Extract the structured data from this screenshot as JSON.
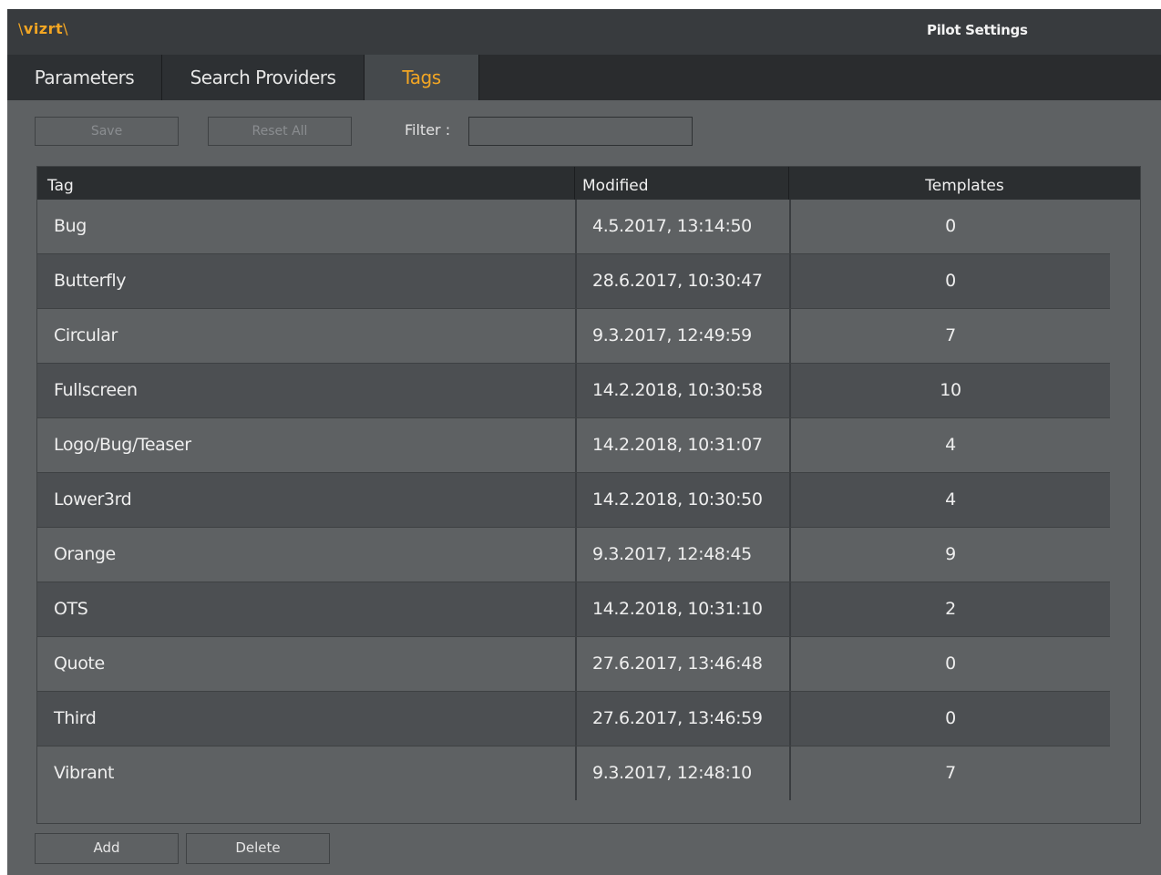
{
  "window": {
    "logo": "vizrt",
    "title": "Pilot Settings"
  },
  "tabs": [
    {
      "label": "Parameters",
      "active": false
    },
    {
      "label": "Search Providers",
      "active": false
    },
    {
      "label": "Tags",
      "active": true
    }
  ],
  "toolbar": {
    "save_label": "Save",
    "reset_label": "Reset All",
    "filter_label": "Filter :",
    "filter_value": ""
  },
  "table": {
    "columns": [
      "Tag",
      "Modified",
      "Templates"
    ],
    "rows": [
      {
        "tag": "Bug",
        "modified": "4.5.2017, 13:14:50",
        "templates": "0"
      },
      {
        "tag": "Butterfly",
        "modified": "28.6.2017, 10:30:47",
        "templates": "0"
      },
      {
        "tag": "Circular",
        "modified": "9.3.2017, 12:49:59",
        "templates": "7"
      },
      {
        "tag": "Fullscreen",
        "modified": "14.2.2018, 10:30:58",
        "templates": "10"
      },
      {
        "tag": "Logo/Bug/Teaser",
        "modified": "14.2.2018, 10:31:07",
        "templates": "4"
      },
      {
        "tag": "Lower3rd",
        "modified": "14.2.2018, 10:30:50",
        "templates": "4"
      },
      {
        "tag": "Orange",
        "modified": "9.3.2017, 12:48:45",
        "templates": "9"
      },
      {
        "tag": "OTS",
        "modified": "14.2.2018, 10:31:10",
        "templates": "2"
      },
      {
        "tag": "Quote",
        "modified": "27.6.2017, 13:46:48",
        "templates": "0"
      },
      {
        "tag": "Third",
        "modified": "27.6.2017, 13:46:59",
        "templates": "0"
      },
      {
        "tag": "Vibrant",
        "modified": "9.3.2017, 12:48:10",
        "templates": "7"
      }
    ]
  },
  "footer": {
    "add_label": "Add",
    "delete_label": "Delete"
  },
  "colors": {
    "accent": "#f3a623",
    "background": "#5e6163",
    "header": "#2b2e30"
  }
}
